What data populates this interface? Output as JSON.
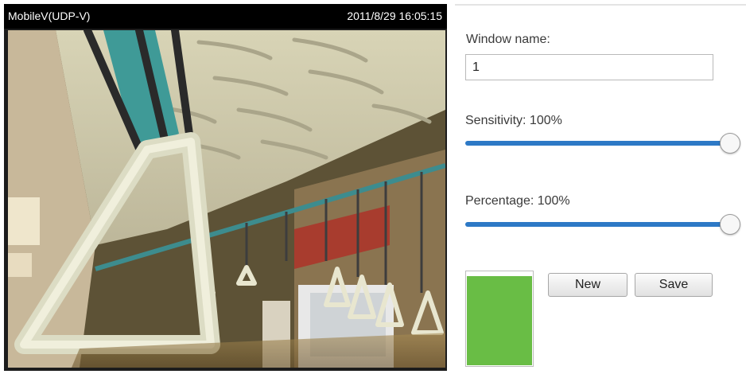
{
  "video": {
    "camera_name": "MobileV(UDP-V)",
    "timestamp": "2011/8/29 16:05:15"
  },
  "window": {
    "name_label": "Window name:",
    "name_value": "1"
  },
  "sensitivity": {
    "label": "Sensitivity: 100%",
    "value_percent": 100
  },
  "percentage": {
    "label": "Percentage: 100%",
    "value_percent": 100
  },
  "indicator": {
    "level_percent": 94,
    "color": "#69bd45"
  },
  "buttons": {
    "new_label": "New",
    "save_label": "Save"
  },
  "colors": {
    "slider_track": "#2d79c6",
    "header_bg": "#000000"
  }
}
